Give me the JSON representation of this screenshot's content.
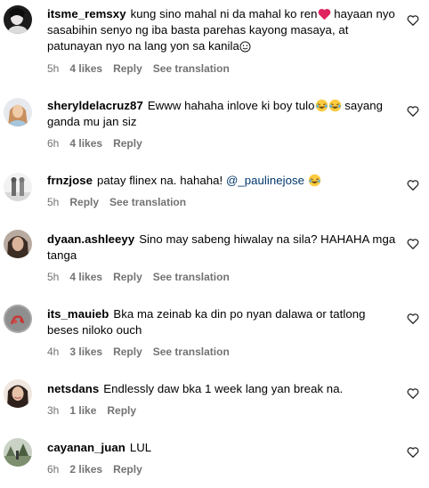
{
  "comments": [
    {
      "username": "itsme_remsxy",
      "text": "kung sino mahal ni da mahal ko ren",
      "text2": " hayaan nyo sasabihin senyo ng iba basta parehas kayong masaya, at patunayan nyo na lang yon sa kanila",
      "time": "5h",
      "likes": "4 likes",
      "reply": "Reply",
      "translate": "See translation",
      "icons": [
        "red-heart-emoji",
        "smile-emoji"
      ]
    },
    {
      "username": "sheryldelacruz87",
      "text": "Ewww hahaha inlove ki boy tulo",
      "text2": " sayang ganda mu jan siz",
      "time": "6h",
      "likes": "4 likes",
      "reply": "Reply",
      "icons": [
        "laughing-tears-emoji",
        "laughing-tears-emoji"
      ]
    },
    {
      "username": "frnzjose",
      "text": "patay flinex na. hahaha! ",
      "mention": "@_paulinejose",
      "time": "5h",
      "reply": "Reply",
      "translate": "See translation",
      "icons": [
        "laughing-tears-emoji"
      ]
    },
    {
      "username": "dyaan.ashleeyy",
      "text": "Sino may sabeng hiwalay na sila? HAHAHA mga tanga",
      "time": "5h",
      "likes": "4 likes",
      "reply": "Reply",
      "translate": "See translation"
    },
    {
      "username": "its_mauieb",
      "text": "Bka ma zeinab ka din po nyan dalawa or tatlong beses niloko ouch",
      "time": "4h",
      "likes": "3 likes",
      "reply": "Reply",
      "translate": "See translation"
    },
    {
      "username": "netsdans",
      "text": "Endlessly daw bka 1 week lang yan break na.",
      "time": "3h",
      "likes": "1 like",
      "reply": "Reply"
    },
    {
      "username": "cayanan_juan",
      "text": "LUL",
      "time": "6h",
      "likes": "2 likes",
      "reply": "Reply"
    }
  ],
  "colors": {
    "meta": "#737373",
    "mention": "#00376b",
    "heart_emoji": "#e0245e"
  }
}
